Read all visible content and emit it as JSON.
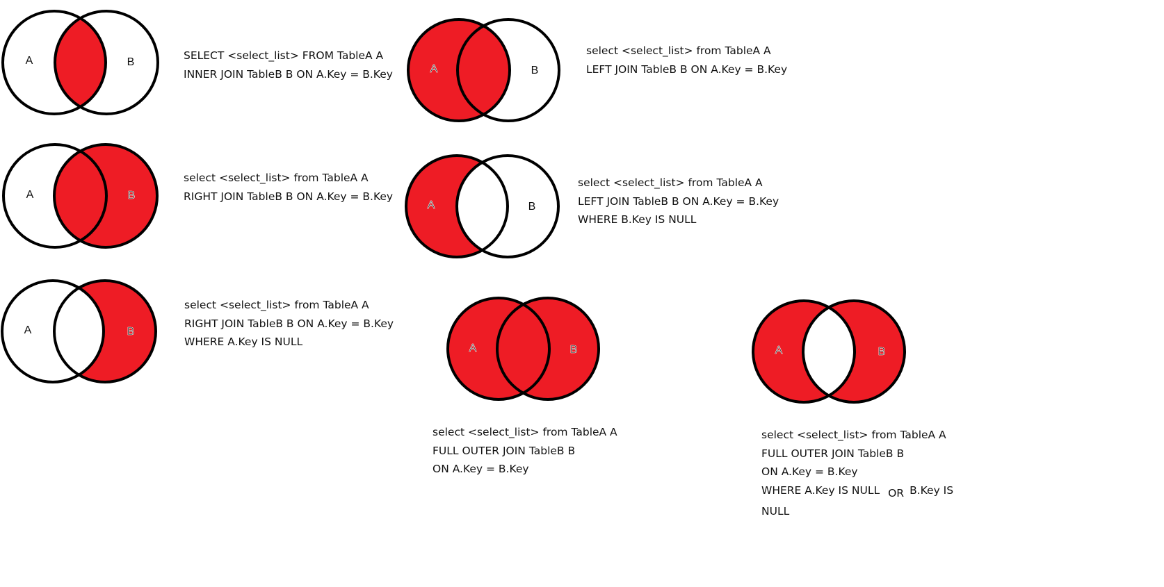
{
  "colors": {
    "fill": "#ee1c25",
    "outline": "#000000",
    "background": "#ffffff",
    "text": "#111111"
  },
  "diagrams": [
    {
      "id": "inner-join",
      "shaded": "intersection",
      "label_a": "A",
      "label_b": "B",
      "sql": [
        "SELECT <select_list> FROM TableA A",
        "INNER JOIN TableB B ON A.Key = B.Key"
      ]
    },
    {
      "id": "left-join",
      "shaded": "a-all",
      "label_a": "A",
      "label_b": "B",
      "sql": [
        "select <select_list> from TableA A",
        "LEFT JOIN TableB B ON A.Key = B.Key"
      ]
    },
    {
      "id": "right-join",
      "shaded": "b-all",
      "label_a": "A",
      "label_b": "B",
      "sql": [
        "select <select_list> from TableA A",
        "RIGHT JOIN TableB B ON A.Key = B.Key"
      ]
    },
    {
      "id": "left-join-exclusive",
      "shaded": "a-only",
      "label_a": "A",
      "label_b": "B",
      "sql": [
        "select <select_list> from TableA A",
        "LEFT JOIN TableB B ON A.Key = B.Key",
        "WHERE B.Key IS NULL"
      ]
    },
    {
      "id": "right-join-exclusive",
      "shaded": "b-only",
      "label_a": "A",
      "label_b": "B",
      "sql": [
        "select <select_list> from TableA A",
        "RIGHT JOIN TableB B ON A.Key = B.Key",
        "WHERE A.Key IS NULL"
      ]
    },
    {
      "id": "full-outer-join",
      "shaded": "union",
      "label_a": "A",
      "label_b": "B",
      "sql": [
        "select <select_list> from TableA A",
        "FULL OUTER JOIN TableB B",
        "ON A.Key = B.Key"
      ]
    },
    {
      "id": "full-outer-join-exclusive",
      "shaded": "symmetric-difference",
      "label_a": "A",
      "label_b": "B",
      "sql": [
        "select <select_list> from TableA A",
        "FULL OUTER JOIN TableB B",
        "ON A.Key = B.Key"
      ],
      "sql_where_left": "WHERE A.Key IS NULL",
      "sql_where_or": "OR",
      "sql_where_right": "B.Key IS",
      "sql_where_tail": "NULL"
    }
  ]
}
